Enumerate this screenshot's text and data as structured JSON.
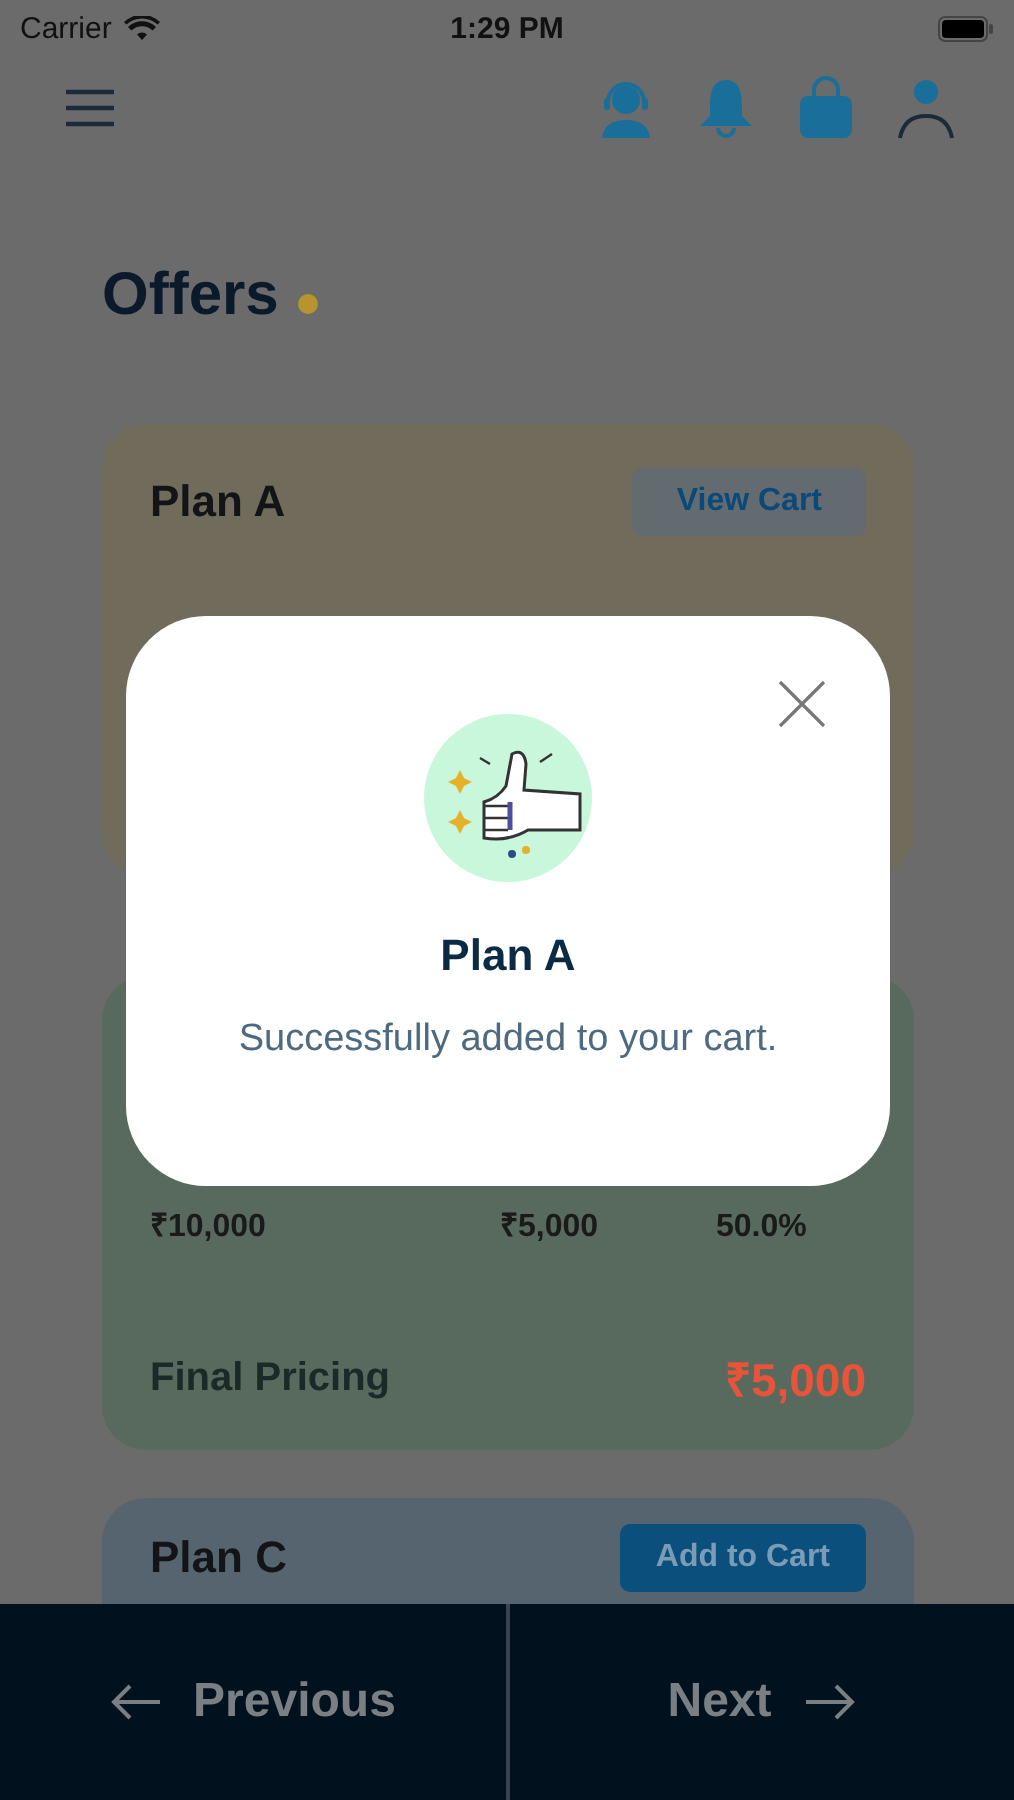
{
  "status_bar": {
    "carrier": "Carrier",
    "time": "1:29 PM"
  },
  "page": {
    "title": "Offers"
  },
  "plans": [
    {
      "kind": "summary",
      "name": "Plan A",
      "color": "#716b5c",
      "action": "View Cart"
    },
    {
      "kind": "details",
      "color": "#58695e",
      "values": [
        "₹10,000",
        "₹5,000",
        "50.0%"
      ],
      "final_label": "Final Pricing",
      "final_price": "₹5,000"
    },
    {
      "kind": "add",
      "name": "Plan C",
      "color": "#566470",
      "action": "Add to Cart"
    }
  ],
  "modal": {
    "title": "Plan A",
    "message": "Successfully added to your cart."
  },
  "nav": {
    "previous": "Previous",
    "next": "Next"
  }
}
